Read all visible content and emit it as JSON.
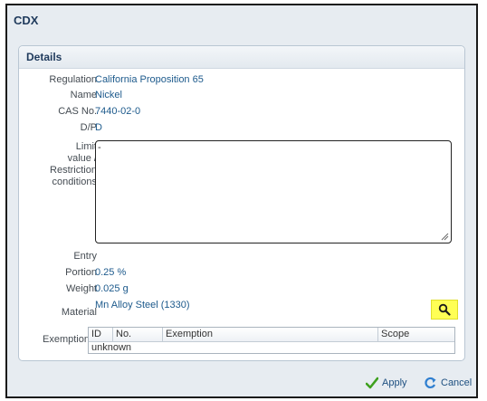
{
  "dialog": {
    "title": "CDX"
  },
  "details": {
    "title": "Details",
    "fields": {
      "regulation": {
        "label": "Regulation",
        "value": "California Proposition 65"
      },
      "name": {
        "label": "Name",
        "value": "Nickel"
      },
      "cas_no": {
        "label": "CAS No.",
        "value": "7440-02-0"
      },
      "dp": {
        "label": "D/P",
        "value": "D"
      },
      "limit": {
        "label_lines": [
          "Limit",
          "value /",
          "Restriction",
          "conditions"
        ],
        "value": ""
      },
      "entry": {
        "label": "Entry"
      },
      "portion": {
        "label": "Portion",
        "value": "0.25 %"
      },
      "weight": {
        "label": "Weight",
        "value": "0.025 g"
      },
      "material": {
        "label": "Material",
        "value": "Mn Alloy Steel (1330)"
      },
      "exemption": {
        "label": "Exemption",
        "columns": [
          "ID",
          "No.",
          "Exemption",
          "Scope"
        ],
        "rows": [
          [
            "unknown"
          ]
        ]
      }
    }
  },
  "buttons": {
    "apply": "Apply",
    "cancel": "Cancel"
  },
  "colors": {
    "highlight": "#ffff55",
    "accent": "#1d5a8c",
    "apply_check": "#3ea01e",
    "cancel_arrow": "#2f7fd0"
  },
  "icons": {
    "search": "magnifier-icon",
    "apply": "check-icon",
    "cancel": "refresh-icon"
  }
}
